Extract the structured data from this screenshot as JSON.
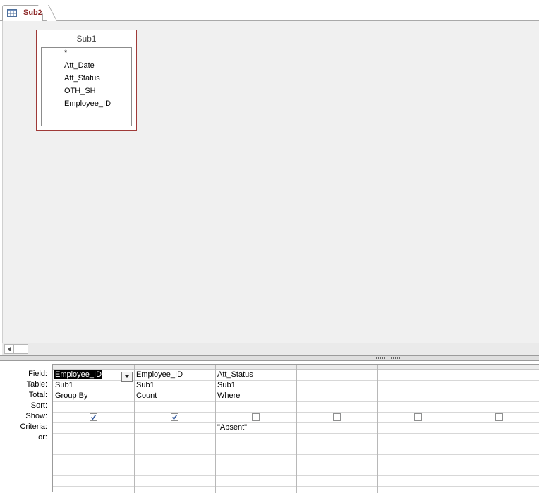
{
  "document_tab": {
    "label": "Sub2",
    "icon": "query-design-icon"
  },
  "field_list": {
    "title": "Sub1",
    "fields": [
      "*",
      "Att_Date",
      "Att_Status",
      "OTH_SH",
      "Employee_ID"
    ]
  },
  "grid": {
    "row_labels": {
      "field": "Field:",
      "table": "Table:",
      "total": "Total:",
      "sort": "Sort:",
      "show": "Show:",
      "criteria": "Criteria:",
      "or": "or:"
    },
    "columns": [
      {
        "field": "Employee_ID",
        "table": "Sub1",
        "total": "Group By",
        "sort": "",
        "show": true,
        "criteria": "",
        "or": ""
      },
      {
        "field": "Employee_ID",
        "table": "Sub1",
        "total": "Count",
        "sort": "",
        "show": true,
        "criteria": "",
        "or": ""
      },
      {
        "field": "Att_Status",
        "table": "Sub1",
        "total": "Where",
        "sort": "",
        "show": false,
        "criteria": "\"Absent\"",
        "or": ""
      },
      {
        "field": "",
        "table": "",
        "total": "",
        "sort": "",
        "show": false,
        "criteria": "",
        "or": ""
      },
      {
        "field": "",
        "table": "",
        "total": "",
        "sort": "",
        "show": false,
        "criteria": "",
        "or": ""
      },
      {
        "field": "",
        "table": "",
        "total": "",
        "sort": "",
        "show": false,
        "criteria": "",
        "or": ""
      }
    ]
  }
}
